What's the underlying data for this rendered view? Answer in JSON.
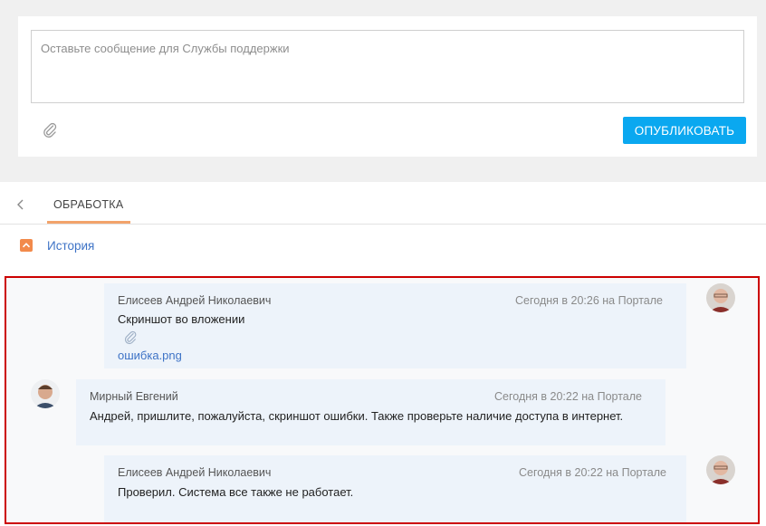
{
  "composer": {
    "placeholder": "Оставьте сообщение для Службы поддержки",
    "publish_label": "ОПУБЛИКОВАТЬ",
    "attach_icon": "paperclip-icon"
  },
  "tabs": {
    "back_icon": "chevron-left-icon",
    "items": [
      {
        "label": "ОБРАБОТКА",
        "active": true
      }
    ]
  },
  "history": {
    "label": "История",
    "toggle_icon": "chevron-up-icon"
  },
  "feed": {
    "messages": [
      {
        "author": "Елисеев Андрей Николаевич",
        "time": "Сегодня в 20:26 на Портале",
        "text": "Скриншот во вложении",
        "attachment": "ошибка.png",
        "side": "right"
      },
      {
        "author": "Мирный Евгений",
        "time": "Сегодня в 20:22 на Портале",
        "text": "Андрей, пришлите, пожалуйста, скриншот ошибки. Также проверьте наличие доступа в интернет.",
        "side": "left"
      },
      {
        "author": "Елисеев Андрей Николаевич",
        "time": "Сегодня в 20:22 на Портале",
        "text": "Проверил. Система все также не работает.",
        "side": "right"
      }
    ]
  },
  "colors": {
    "accent": "#0aa8f0",
    "tab_underline": "#f2a36b",
    "link": "#3e73c6",
    "message_bg": "#edf3fa",
    "highlight_border": "#cc0000"
  }
}
